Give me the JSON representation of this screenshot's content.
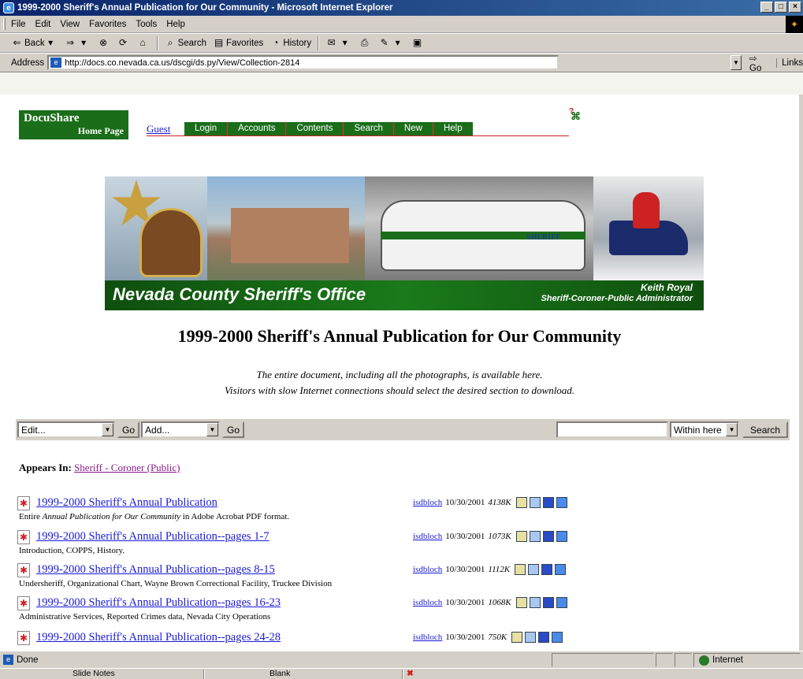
{
  "window": {
    "title": "1999-2000 Sheriff's Annual Publication for Our Community - Microsoft Internet Explorer",
    "controls": [
      "_",
      "□",
      "×"
    ]
  },
  "menu": [
    "File",
    "Edit",
    "View",
    "Favorites",
    "Tools",
    "Help"
  ],
  "toolbar": {
    "back": "Back",
    "search": "Search",
    "favorites": "Favorites",
    "history": "History"
  },
  "address": {
    "label": "Address",
    "url": "http://docs.co.nevada.ca.us/dscgi/ds.py/View/Collection-2814",
    "go": "Go",
    "links": "Links"
  },
  "docushare": {
    "logo_line1": "DocuShare",
    "logo_line2": "Home Page",
    "user": "Guest",
    "nav": [
      "Login",
      "Accounts",
      "Contents",
      "Search",
      "New",
      "Help"
    ]
  },
  "banner": {
    "org": "Nevada County Sheriff's Office",
    "person_name": "Keith Royal",
    "person_role": "Sheriff-Coroner-Public Administrator",
    "car_label": "SHERIFF"
  },
  "page": {
    "title": "1999-2000 Sheriff's Annual Publication for Our Community",
    "intro_line1": "The entire document, including all the photographs, is available here.",
    "intro_line2": "Visitors with slow Internet connections should select the desired section to download."
  },
  "actions": {
    "edit_select": "Edit...",
    "go1": "Go",
    "add_select": "Add...",
    "go2": "Go",
    "search_scope": "Within here",
    "search_button": "Search"
  },
  "appears_in": {
    "label": "Appears In:",
    "link": "Sheriff - Coroner (Public)"
  },
  "documents": [
    {
      "title": "1999-2000 Sheriff's Annual Publication",
      "desc_prefix": "Entire ",
      "desc_italic": "Annual Publication for Our Community",
      "desc_suffix": " in Adobe Acrobat PDF format.",
      "owner": "isdbloch",
      "date": "10/30/2001",
      "size": "4138K"
    },
    {
      "title": "1999-2000 Sheriff's Annual Publication--pages 1-7",
      "desc": "Introduction, COPPS, History.",
      "owner": "isdbloch",
      "date": "10/30/2001",
      "size": "1073K"
    },
    {
      "title": "1999-2000 Sheriff's Annual Publication--pages 8-15",
      "desc": "Undersheriff, Organizational Chart, Wayne Brown Correctional Facility, Truckee Division",
      "owner": "isdbloch",
      "date": "10/30/2001",
      "size": "1112K"
    },
    {
      "title": "1999-2000 Sheriff's Annual Publication--pages 16-23",
      "desc": "Administrative Services, Reported Crimes data, Nevada City Operations",
      "owner": "isdbloch",
      "date": "10/30/2001",
      "size": "1068K"
    },
    {
      "title": "1999-2000 Sheriff's Annual Publication--pages 24-28",
      "desc": "",
      "owner": "isdbloch",
      "date": "10/30/2001",
      "size": "750K"
    }
  ],
  "status": {
    "text": "Done",
    "zone": "Internet"
  },
  "taskbar": [
    "Slide Notes",
    "Blank"
  ],
  "colors": {
    "docushare_green": "#1a6e1a",
    "link_blue": "#1a1ad8",
    "visited_purple": "#8a1a8a",
    "titlebar_blue": "#0a246a"
  }
}
